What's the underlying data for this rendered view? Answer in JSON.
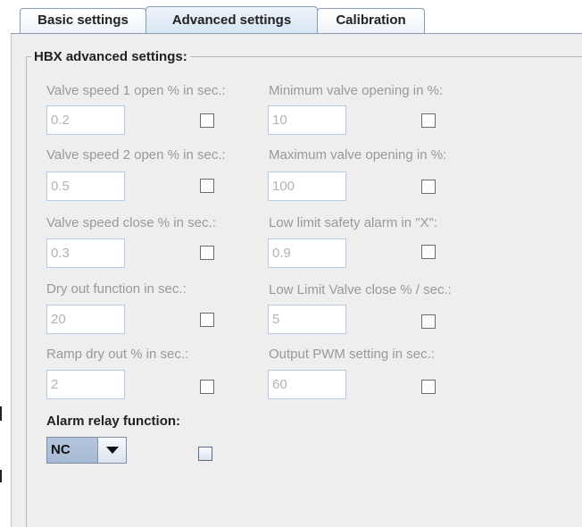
{
  "tabs": [
    {
      "label": "Basic settings"
    },
    {
      "label": "Advanced settings"
    },
    {
      "label": "Calibration"
    }
  ],
  "active_tab": "Advanced settings",
  "group": {
    "title": "HBX advanced settings:"
  },
  "settings": {
    "valve_speed_1": {
      "label": "Valve speed 1 open % in sec.:",
      "value": "0.2"
    },
    "min_valve_opening": {
      "label": "Minimum valve opening in %:",
      "value": "10"
    },
    "valve_speed_2": {
      "label": "Valve speed 2 open % in sec.:",
      "value": "0.5"
    },
    "max_valve_opening": {
      "label": "Maximum valve opening in %:",
      "value": "100"
    },
    "valve_speed_close": {
      "label": "Valve speed close % in sec.:",
      "value": "0.3"
    },
    "low_limit_alarm": {
      "label": "Low limit safety alarm in \"X\":",
      "value": "0.9"
    },
    "dry_out_function": {
      "label": "Dry out function in sec.:",
      "value": "20"
    },
    "low_limit_valve_close": {
      "label": "Low Limit Valve close % / sec.:",
      "value": "5"
    },
    "ramp_dry_out": {
      "label": "Ramp dry out % in sec.:",
      "value": "2"
    },
    "output_pwm": {
      "label": "Output PWM setting in sec.:",
      "value": "60"
    }
  },
  "alarm_relay": {
    "label": "Alarm relay function:",
    "selected": "NC"
  },
  "colors": {
    "disabled_text": "#999999",
    "field_border": "#b7cbe6",
    "combo_fill": "#a6bad4",
    "panel_bg": "#eeeeee"
  }
}
